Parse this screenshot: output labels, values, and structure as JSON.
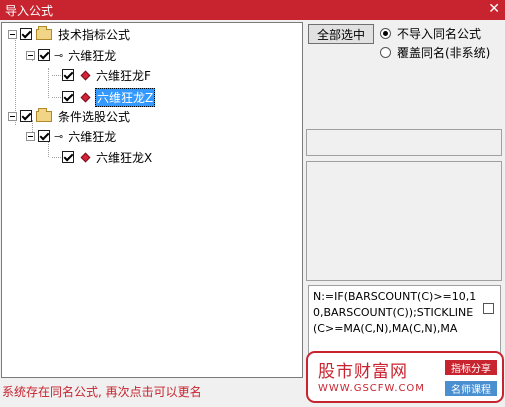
{
  "window": {
    "title": "导入公式",
    "close_glyph": "✕"
  },
  "tree": {
    "root1": {
      "label": "技术指标公式"
    },
    "root1_child": {
      "label": "六维狂龙"
    },
    "leaf1": {
      "label": "六维狂龙F"
    },
    "leaf2": {
      "label": "六维狂龙Z"
    },
    "root2": {
      "label": "条件选股公式"
    },
    "root2_child": {
      "label": "六维狂龙"
    },
    "leaf3": {
      "label": "六维狂龙X"
    }
  },
  "options": {
    "select_all_label": "全部选中",
    "radio_no_import": "不导入同名公式",
    "radio_overwrite": "覆盖同名(非系统)"
  },
  "code": {
    "text": "N:=IF(BARSCOUNT(C)>=10,10,BARSCOUNT(C));STICKLINE(C>=MA(C,N),MA(C,N),MA"
  },
  "status": {
    "text": "系统存在同名公式, 再次点击可以更名"
  },
  "watermark": {
    "brand": "股市财富网",
    "url": "WWW.GSCFW.COM",
    "tag1": "指标分享",
    "tag2": "名师课程"
  },
  "colors": {
    "accent": "#c8242f",
    "selection": "#3399ff"
  }
}
